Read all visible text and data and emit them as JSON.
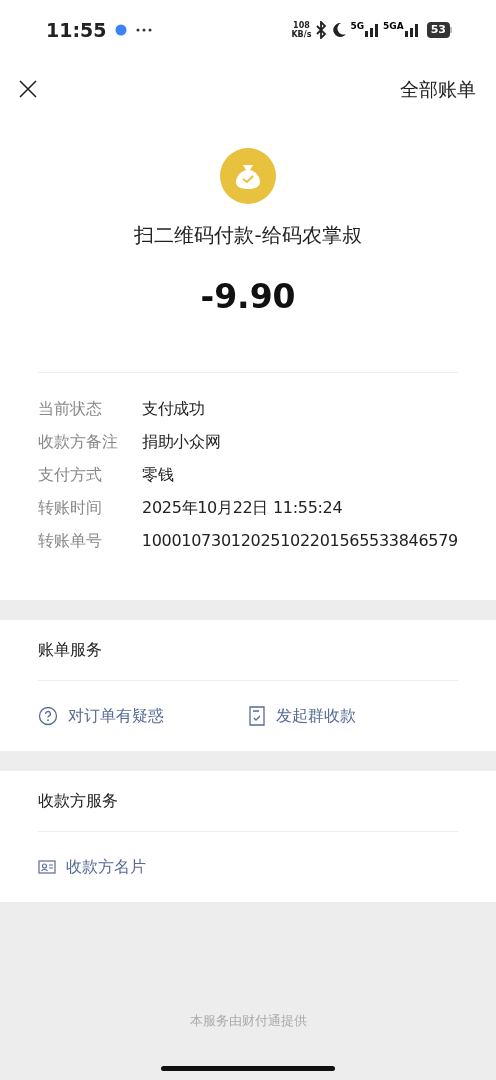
{
  "status_bar": {
    "time": "11:55",
    "net_speed": [
      "108",
      "KB/s"
    ],
    "signals": [
      "5G",
      "5GA"
    ],
    "battery": "53"
  },
  "header": {
    "action": "全部账单"
  },
  "summary": {
    "title": "扫二维码付款-给码农掌叔",
    "amount": "-9.90"
  },
  "details": [
    {
      "label": "当前状态",
      "value": "支付成功"
    },
    {
      "label": "收款方备注",
      "value": "捐助小众网"
    },
    {
      "label": "支付方式",
      "value": "零钱"
    },
    {
      "label": "转账时间",
      "value": "2025年10月22日 11:55:24"
    },
    {
      "label": "转账单号",
      "value": "10001073012025102201565533846579"
    }
  ],
  "sections": [
    {
      "title": "账单服务",
      "items": [
        {
          "kind": "question",
          "label": "对订单有疑惑"
        },
        {
          "kind": "receipt",
          "label": "发起群收款"
        }
      ]
    },
    {
      "title": "收款方服务",
      "items": [
        {
          "kind": "card",
          "label": "收款方名片"
        }
      ]
    }
  ],
  "footer": "本服务由财付通提供"
}
